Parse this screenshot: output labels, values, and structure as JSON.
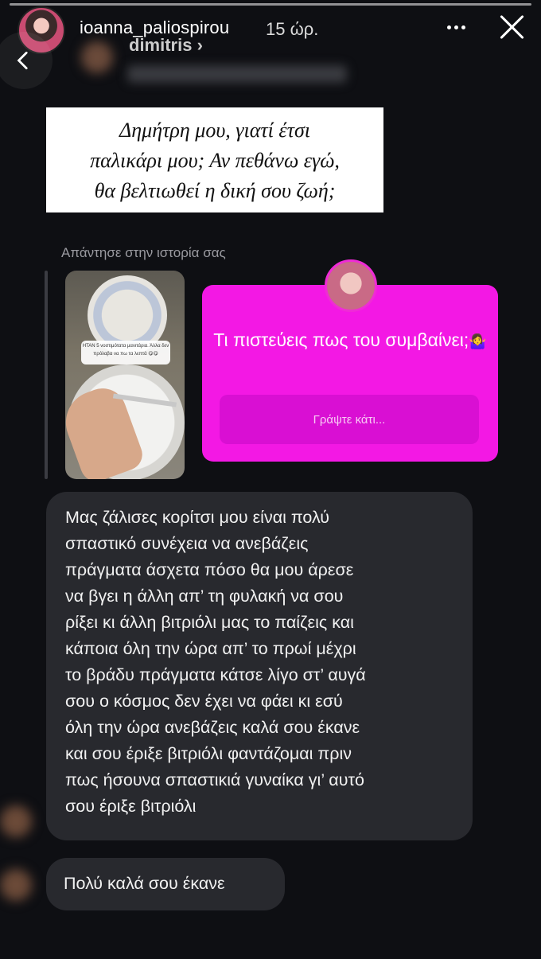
{
  "header": {
    "username": "ioanna_paliospirou",
    "time": "15 ώρ.",
    "dm_name": "dimitris"
  },
  "quote": {
    "text": "Δημήτρη μου, γιατί έτσι\nπαλικάρι μου; Αν πεθάνω εγώ,\nθα βελτιωθεί η δική σου ζωή;"
  },
  "reply": {
    "label": "Απάντησε στην ιστορία σας"
  },
  "story_thumb": {
    "sticker": "ΗΤΑΝ 5 νοστιμότατα μανιτάρια. Άλλα δεν πρόλαβα να πω τα λεπτά 😋😋"
  },
  "question_sticker": {
    "text": "Τι πιστεύεις πως του συμβαίνει;",
    "emoji": "🤷‍♀️",
    "placeholder": "Γράψτε κάτι..."
  },
  "messages": [
    {
      "text": "Μας ζάλισες κορίτσι μου είναι πολύ\nσπαστικό συνέχεια να ανεβάζεις\nπράγματα άσχετα πόσο θα μου άρεσε\nνα βγει η άλλη απ’ τη φυλακή να σου\nρίξει κι άλλη βιτριόλι μας το παίζεις και\nκάποια όλη την ώρα απ’ το πρωί μέχρι\nτο βράδυ πράγματα κάτσε λίγο στ’ αυγά\nσου ο κόσμος δεν έχει να φάει κι εσύ\nόλη την ώρα ανεβάζεις καλά σου έκανε\nκαι σου έριξε βιτριόλι φαντάζομαι πριν\nπως ήσουνα σπαστικιά γυναίκα γι’ αυτό\nσου έριξε βιτριόλι"
    },
    {
      "text": "Πολύ καλά σου έκανε"
    }
  ]
}
